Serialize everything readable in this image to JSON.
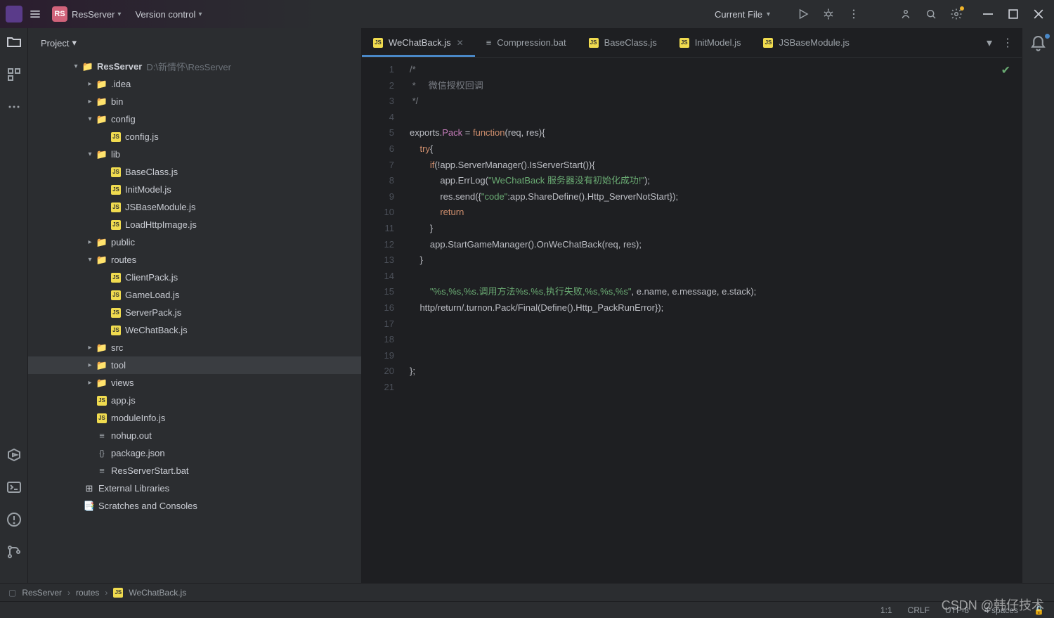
{
  "titlebar": {
    "project_badge": "RS",
    "project_name": "ResServer",
    "vc_label": "Version control",
    "current_file": "Current File"
  },
  "sidebar": {
    "header": "Project",
    "root": "ResServer",
    "root_path": "D:\\新情怀\\ResServer",
    "nodes": {
      "idea": ".idea",
      "bin": "bin",
      "config": "config",
      "config_js": "config.js",
      "lib": "lib",
      "baseclass": "BaseClass.js",
      "initmodel": "InitModel.js",
      "jsbasemodule": "JSBaseModule.js",
      "loadhttpimage": "LoadHttpImage.js",
      "public": "public",
      "routes": "routes",
      "clientpack": "ClientPack.js",
      "gameload": "GameLoad.js",
      "serverpack": "ServerPack.js",
      "wechatback": "WeChatBack.js",
      "src": "src",
      "tool": "tool",
      "views": "views",
      "appjs": "app.js",
      "moduleinfo": "moduleInfo.js",
      "nohup": "nohup.out",
      "packagejson": "package.json",
      "resserverstart": "ResServerStart.bat",
      "external": "External Libraries",
      "scratches": "Scratches and Consoles"
    }
  },
  "tabs": [
    {
      "label": "WeChatBack.js",
      "type": "js",
      "active": true,
      "closable": true
    },
    {
      "label": "Compression.bat",
      "type": "bat",
      "active": false
    },
    {
      "label": "BaseClass.js",
      "type": "js",
      "active": false
    },
    {
      "label": "InitModel.js",
      "type": "js",
      "active": false
    },
    {
      "label": "JSBaseModule.js",
      "type": "js",
      "active": false
    }
  ],
  "code_lines": [
    {
      "n": 1,
      "html": "<span class='c-comm'>/*</span>"
    },
    {
      "n": 2,
      "html": "<span class='c-comm'> *     微信授权回调</span>"
    },
    {
      "n": 3,
      "html": "<span class='c-comm'> */</span>"
    },
    {
      "n": 4,
      "html": ""
    },
    {
      "n": 5,
      "html": "exports.<span class='c-prop'>Pack</span> = <span class='c-kw'>function</span>(req, res){"
    },
    {
      "n": 6,
      "html": "    <span class='c-kw'>try</span>{"
    },
    {
      "n": 7,
      "html": "        <span class='c-kw'>if</span>(!app.ServerManager().IsServerStart()){"
    },
    {
      "n": 8,
      "html": "            app.ErrLog(<span class='c-str'>\"WeChatBack 服务器没有初始化成功!\"</span>);"
    },
    {
      "n": 9,
      "html": "            res.send({<span class='c-str'>\"code\"</span>:app.ShareDefine().Http_ServerNotStart});"
    },
    {
      "n": 10,
      "html": "            <span class='c-kw'>return</span>"
    },
    {
      "n": 11,
      "html": "        }"
    },
    {
      "n": 12,
      "html": "        app.StartGameManager().OnWeChatBack(req, res);"
    },
    {
      "n": 13,
      "html": "    }"
    },
    {
      "n": 14,
      "html": ""
    },
    {
      "n": 15,
      "html": "        <span class='c-str'>\"%s,%s,%s.调用方法%s.%s,执行失败,%s,%s,%s\"</span>, e.name, e.message, e.stack);"
    },
    {
      "n": 16,
      "html": "    http/return/.turnon.Pack/Final(Define().Http_PackRunError});"
    },
    {
      "n": 17,
      "html": ""
    },
    {
      "n": 18,
      "html": ""
    },
    {
      "n": 19,
      "html": ""
    },
    {
      "n": 20,
      "html": "};"
    },
    {
      "n": 21,
      "html": ""
    }
  ],
  "breadcrumb": {
    "root": "ResServer",
    "folder": "routes",
    "file": "WeChatBack.js"
  },
  "status": {
    "pos": "1:1",
    "lineEnding": "CRLF",
    "encoding": "UTF-8",
    "indent": "4 spaces"
  },
  "watermark": "CSDN @韩仔技术"
}
